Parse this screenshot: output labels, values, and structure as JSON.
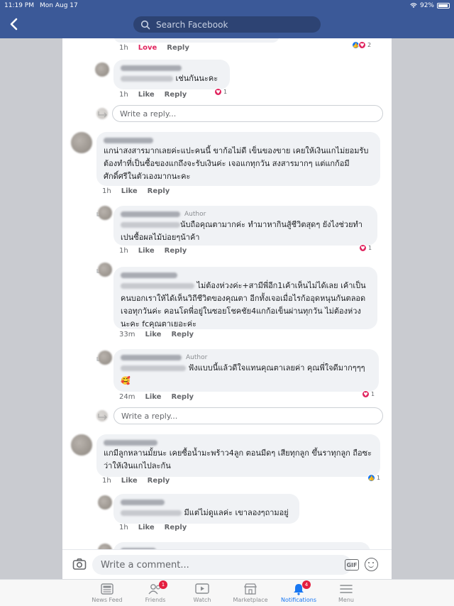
{
  "status_bar": {
    "time": "11:19 PM",
    "date": "Mon Aug 17",
    "battery": "92%"
  },
  "header": {
    "search_placeholder": "Search Facebook"
  },
  "colors": {
    "brand": "#3b5998",
    "love": "#e0245e",
    "like": "#1877f2",
    "badge": "#e41e3f"
  },
  "comments": [
    {
      "id": "c0",
      "time": "1h",
      "reaction_label": "Love",
      "reply": "Reply",
      "reactions": "2",
      "reaction_icons": [
        "like-icon",
        "heart-icon"
      ]
    },
    {
      "id": "r1",
      "text": "เช่นกันนะคะ",
      "time": "1h",
      "like": "Like",
      "reply": "Reply",
      "reactions": "1",
      "reaction_icons": [
        "heart-icon"
      ]
    },
    {
      "id": "c2",
      "text": "แกน่าสงสารมากเลยค่ะแปะคนนี้ ขาก้อไม่ดี เข็นของขาย เคยให้เงินแกไม่ยอมรับ ต้องทำที่เป็นซื้อของแกถึงจะรับเงินค่ะ เจอแกทุกวัน สงสารมากๆ แต่แกก้อมีศักดิ์ศรีในตัวเองมากนะคะ",
      "time": "1h",
      "like": "Like",
      "reply": "Reply"
    },
    {
      "id": "r3",
      "badge": "Author",
      "text": "นับถือคุณตามากค่ะ ทำมาหากินสู้ชีวิตสุดๆ ยังไงช่วยทำเปนซื้อผลไม้บ่อยๆน้าค้า",
      "time": "1h",
      "like": "Like",
      "reply": "Reply",
      "reactions": "1",
      "reaction_icons": [
        "heart-icon"
      ]
    },
    {
      "id": "r4",
      "text": "ไม่ต้องห่วงค่ะ+สามีพี่อีก1เค้าเห็นไม่ได้เลย เค้าเป็นคนบอกเราให้ได้เห็นวิถีชีวิตของคุณตา อีกทั้งเจอเมื่อไรก้ออุดหนุนกันตลอด เจอทุกวันค่ะ คอนโดพี่อยู่ในซอยโชคชัย4แกก้อเข็นผ่านทุกวัน ไม่ต้องห่วงนะคะ fcคุณตาเยอะค่ะ",
      "time": "33m",
      "like": "Like",
      "reply": "Reply"
    },
    {
      "id": "r5",
      "badge": "Author",
      "text": "ฟังแบบนี้แล้วดีใจแทนคุณตาเลยค่า คุณพี่ใจดีมากๆๆๆ 🥰",
      "time": "24m",
      "like": "Like",
      "reply": "Reply",
      "reactions": "1",
      "reaction_icons": [
        "heart-icon"
      ]
    },
    {
      "id": "c6",
      "text": "แกมีลูกหลานมั้ยนะ เคยซื้อน้ำมะพร้าว4ลูก ตอนมีดๆ เสียทุกลูก ขึ้นราทุกลูก ถือซะว่าให้เงินแกไปละกัน",
      "time": "1h",
      "like": "Like",
      "reply": "Reply",
      "reactions": "1",
      "reaction_icons": [
        "like-icon"
      ]
    },
    {
      "id": "r7",
      "text": "มีแต่ไม่ดูแลค่ะ เขาลองๆถามอยู่",
      "time": "1h",
      "like": "Like",
      "reply": "Reply"
    }
  ],
  "reply_box": {
    "placeholder": "Write a reply..."
  },
  "composer": {
    "placeholder": "Write a comment...",
    "gif": "GIF"
  },
  "tabs": [
    {
      "label": "News Feed",
      "icon": "news-feed-icon"
    },
    {
      "label": "Friends",
      "icon": "friends-icon",
      "badge": "1"
    },
    {
      "label": "Watch",
      "icon": "watch-icon"
    },
    {
      "label": "Marketplace",
      "icon": "marketplace-icon"
    },
    {
      "label": "Notifications",
      "icon": "bell-icon",
      "badge": "4",
      "active": true
    },
    {
      "label": "Menu",
      "icon": "menu-icon"
    }
  ]
}
